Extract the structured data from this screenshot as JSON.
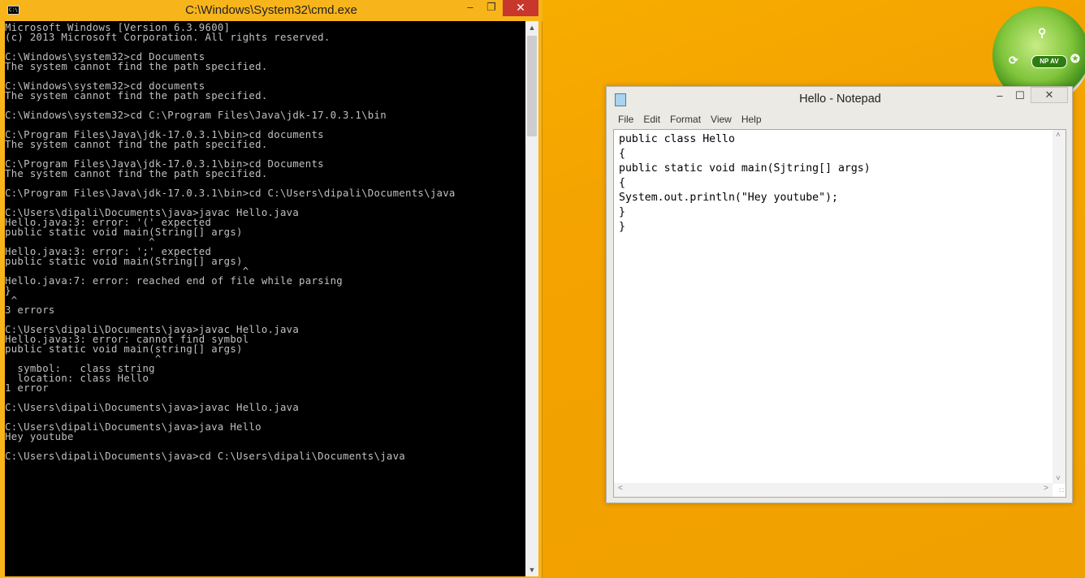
{
  "cmd": {
    "title": "C:\\Windows\\System32\\cmd.exe",
    "icon_label": "C:\\",
    "min_glyph": "–",
    "max_glyph": "❐",
    "close_glyph": "✕",
    "scroll_up_glyph": "▲",
    "scroll_down_glyph": "▼",
    "console_text": "Microsoft Windows [Version 6.3.9600]\n(c) 2013 Microsoft Corporation. All rights reserved.\n\nC:\\Windows\\system32>cd Documents\nThe system cannot find the path specified.\n\nC:\\Windows\\system32>cd documents\nThe system cannot find the path specified.\n\nC:\\Windows\\system32>cd C:\\Program Files\\Java\\jdk-17.0.3.1\\bin\n\nC:\\Program Files\\Java\\jdk-17.0.3.1\\bin>cd documents\nThe system cannot find the path specified.\n\nC:\\Program Files\\Java\\jdk-17.0.3.1\\bin>cd Documents\nThe system cannot find the path specified.\n\nC:\\Program Files\\Java\\jdk-17.0.3.1\\bin>cd C:\\Users\\dipali\\Documents\\java\n\nC:\\Users\\dipali\\Documents\\java>javac Hello.java\nHello.java:3: error: '(' expected\npublic static void main(String[] args)\n                       ^\nHello.java:3: error: ';' expected\npublic static void main(String[] args)\n                                      ^\nHello.java:7: error: reached end of file while parsing\n}\n ^\n3 errors\n\nC:\\Users\\dipali\\Documents\\java>javac Hello.java\nHello.java:3: error: cannot find symbol\npublic static void main(string[] args)\n                        ^\n  symbol:   class string\n  location: class Hello\n1 error\n\nC:\\Users\\dipali\\Documents\\java>javac Hello.java\n\nC:\\Users\\dipali\\Documents\\java>java Hello\nHey youtube\n\nC:\\Users\\dipali\\Documents\\java>cd C:\\Users\\dipali\\Documents\\java"
  },
  "notepad": {
    "title": "Hello - Notepad",
    "min_glyph": "–",
    "max_glyph": "☐",
    "close_glyph": "✕",
    "menu": [
      "File",
      "Edit",
      "Format",
      "View",
      "Help"
    ],
    "content": "public class Hello\n{\npublic static void main(Sjtring[] args)\n{\nSystem.out.println(\"Hey youtube\");\n}\n}",
    "scroll_up_glyph": "˄",
    "scroll_down_glyph": "˅",
    "scroll_left_glyph": "˂",
    "scroll_right_glyph": "˃",
    "grip_glyph": "∷"
  },
  "antivirus": {
    "badge": "NP AV",
    "icons": [
      "search-icon",
      "refresh-icon",
      "wrench-icon"
    ]
  },
  "colors": {
    "desktop": "#f5a800",
    "console_bg": "#000000",
    "console_fg": "#c0c0c0",
    "close_red": "#c7372b"
  }
}
